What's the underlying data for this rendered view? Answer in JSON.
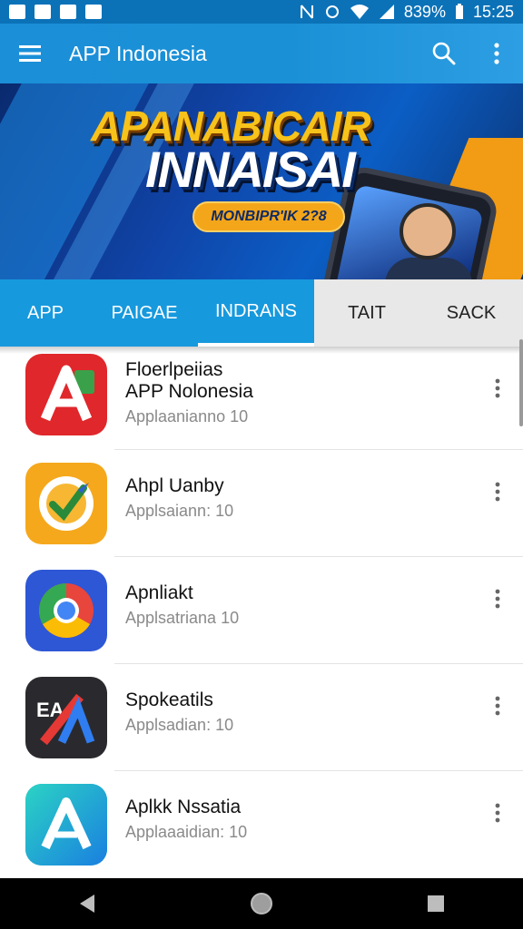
{
  "status_bar": {
    "battery_percent": "839%",
    "time": "15:25"
  },
  "app_bar": {
    "title": "APP Indonesia",
    "menu_icon": "hamburger-menu-icon",
    "search_icon": "search-icon",
    "overflow_icon": "more-vert-icon"
  },
  "banner": {
    "headline_1": "APANABICAIR",
    "headline_2": "INNAISAI",
    "pill": "MONBIPR'IK 2?8"
  },
  "tabs": [
    {
      "label": "APP",
      "style": "blue"
    },
    {
      "label": "PAIGAE",
      "style": "blue"
    },
    {
      "label": "INDRANS",
      "style": "blue",
      "active": true
    },
    {
      "label": "TAIT",
      "style": "gray"
    },
    {
      "label": "SACK",
      "style": "gray"
    }
  ],
  "apps": [
    {
      "title_line1": "Floerlpeiias",
      "title_line2": "APP Nolonesia",
      "subtitle": "Applaanianno 10",
      "icon": "letter-a-red-app-icon",
      "icon_color": "#e0272b"
    },
    {
      "title_line1": "Ahpl Uanby",
      "title_line2": "",
      "subtitle": "Applsaiann: 10",
      "icon": "compass-check-app-icon",
      "icon_color": "#f5a81c"
    },
    {
      "title_line1": "Apnliakt",
      "title_line2": "",
      "subtitle": "Applsatriana 10",
      "icon": "chrome-like-app-icon",
      "icon_color": "#2e57d6"
    },
    {
      "title_line1": "Spokeatils",
      "title_line2": "",
      "subtitle": "Applsadian: 10",
      "icon": "eaa-dark-app-icon",
      "icon_color": "#2a2a2e"
    },
    {
      "title_line1": "Aplkk Nssatia",
      "title_line2": "",
      "subtitle": "Applaaaidian: 10",
      "icon": "letter-a-teal-app-icon",
      "icon_color": "#1fb3d9"
    }
  ],
  "nav_bar": {
    "back_icon": "back-triangle-icon",
    "home_icon": "home-circle-icon",
    "recents_icon": "recents-square-icon"
  }
}
